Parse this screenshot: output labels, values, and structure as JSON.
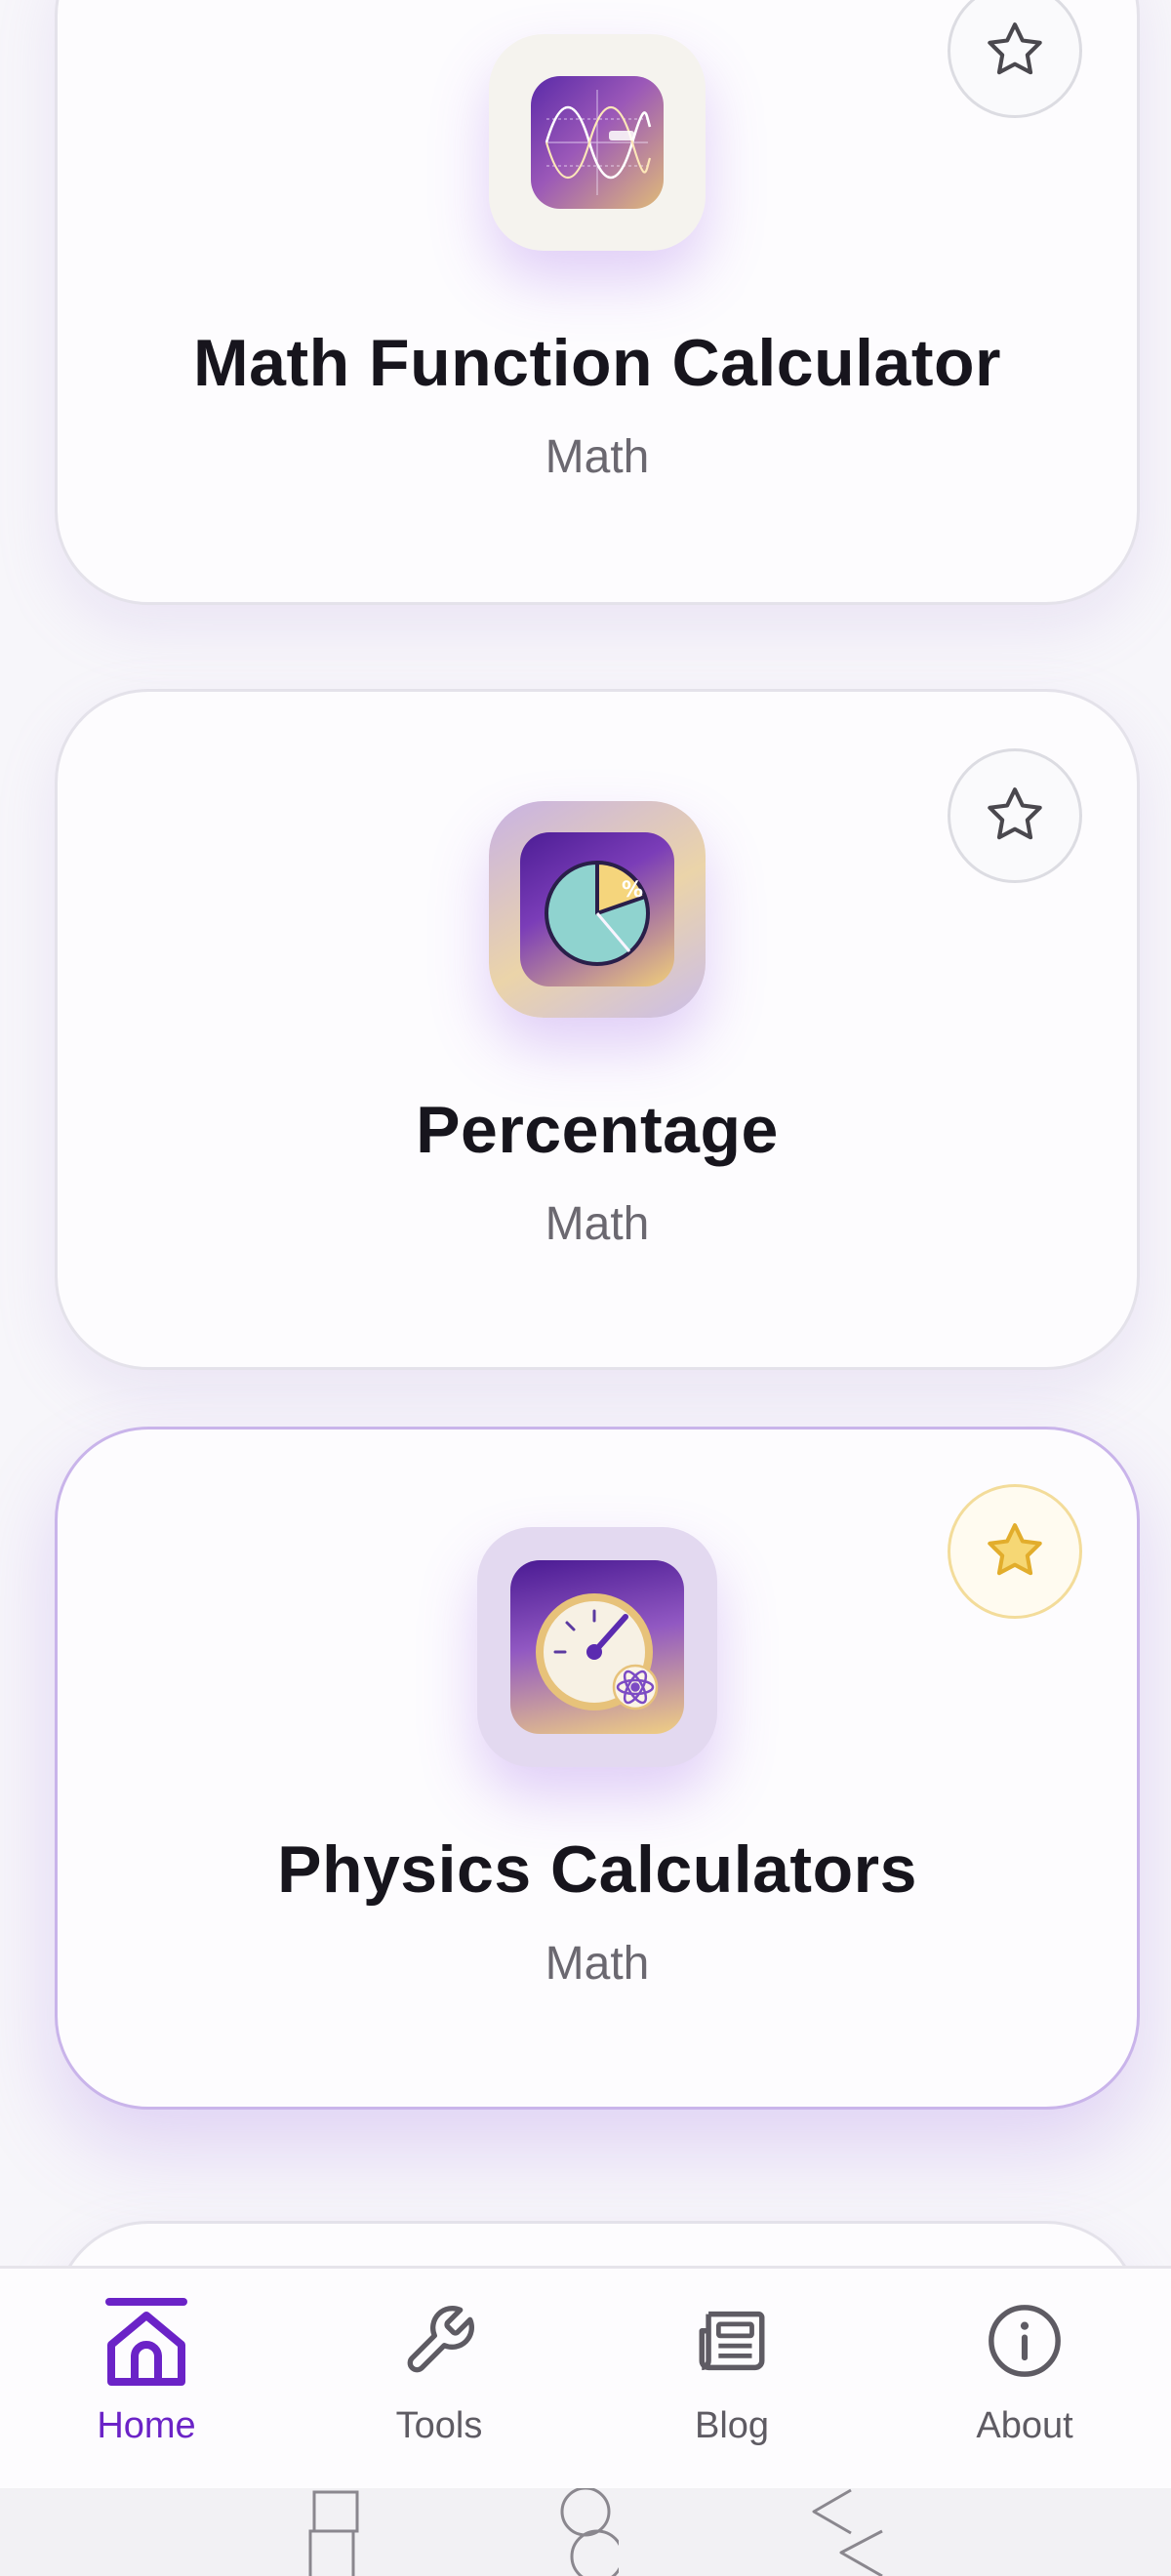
{
  "cards": [
    {
      "title": "Math Function Calculator",
      "category": "Math",
      "favorite": false,
      "icon": "function-graph-icon"
    },
    {
      "title": "Percentage",
      "category": "Math",
      "favorite": false,
      "icon": "pie-percentage-icon"
    },
    {
      "title": "Physics Calculators",
      "category": "Math",
      "favorite": true,
      "icon": "gauge-atom-icon"
    }
  ],
  "nav": {
    "items": [
      {
        "label": "Home",
        "icon": "home-icon",
        "active": true
      },
      {
        "label": "Tools",
        "icon": "wrench-icon",
        "active": false
      },
      {
        "label": "Blog",
        "icon": "newspaper-icon",
        "active": false
      },
      {
        "label": "About",
        "icon": "info-icon",
        "active": false
      }
    ]
  },
  "system_nav": [
    "recents-button",
    "home-button",
    "back-button"
  ],
  "colors": {
    "accent": "#6b23c7",
    "favorite_star": "#e8b838",
    "card_border_highlight": "#c9b4ea",
    "text_primary": "#17151d",
    "text_secondary": "#6b6870"
  }
}
